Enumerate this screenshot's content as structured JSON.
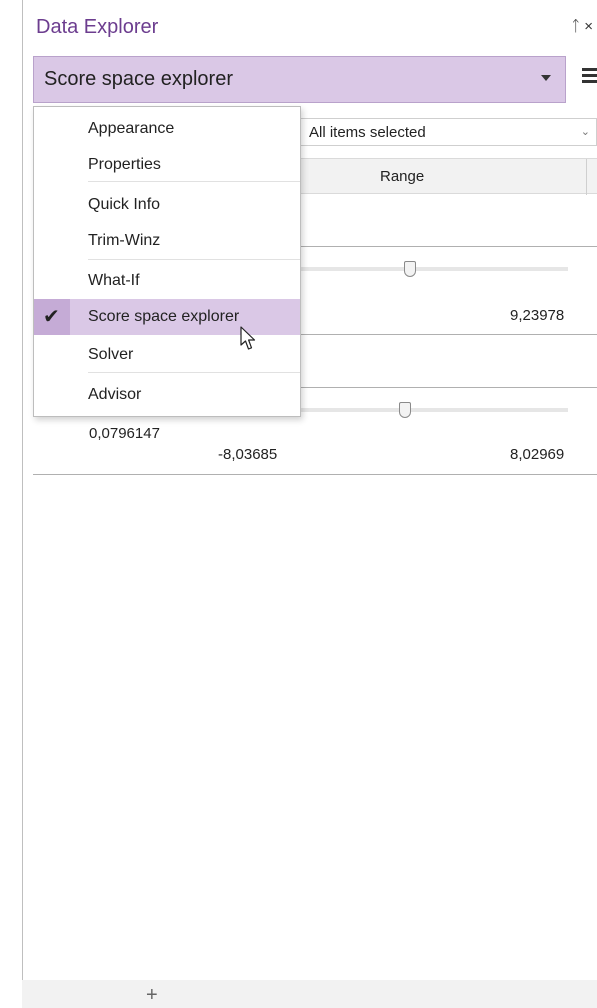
{
  "panel": {
    "title": "Data Explorer",
    "pin_icon": "pin-icon",
    "close_icon": "close-icon",
    "title_icons_text": "ᚁ ×"
  },
  "selector": {
    "value": "Score space explorer",
    "caret_icon": "caret-down-icon"
  },
  "toolbar": {
    "menu_icon": "hamburger-icon"
  },
  "filter": {
    "value": "All items selected"
  },
  "table": {
    "column": "Range"
  },
  "rows": [
    {
      "max": "9,23978"
    },
    {
      "value": "0,0796147",
      "min": "-8,03685",
      "max": "8,02969"
    }
  ],
  "menu": {
    "items": [
      {
        "label": "Appearance"
      },
      {
        "label": "Properties"
      },
      {
        "label": "Quick Info"
      },
      {
        "label": "Trim-Winz"
      },
      {
        "label": "What-If"
      },
      {
        "label": "Score space explorer",
        "checked": true
      },
      {
        "label": "Solver"
      },
      {
        "label": "Advisor"
      }
    ]
  },
  "footer": {
    "add_icon": "plus-icon"
  },
  "colors": {
    "accent": "#6c3d8f",
    "selection": "#dac8e6",
    "check": "#c5abd6"
  }
}
